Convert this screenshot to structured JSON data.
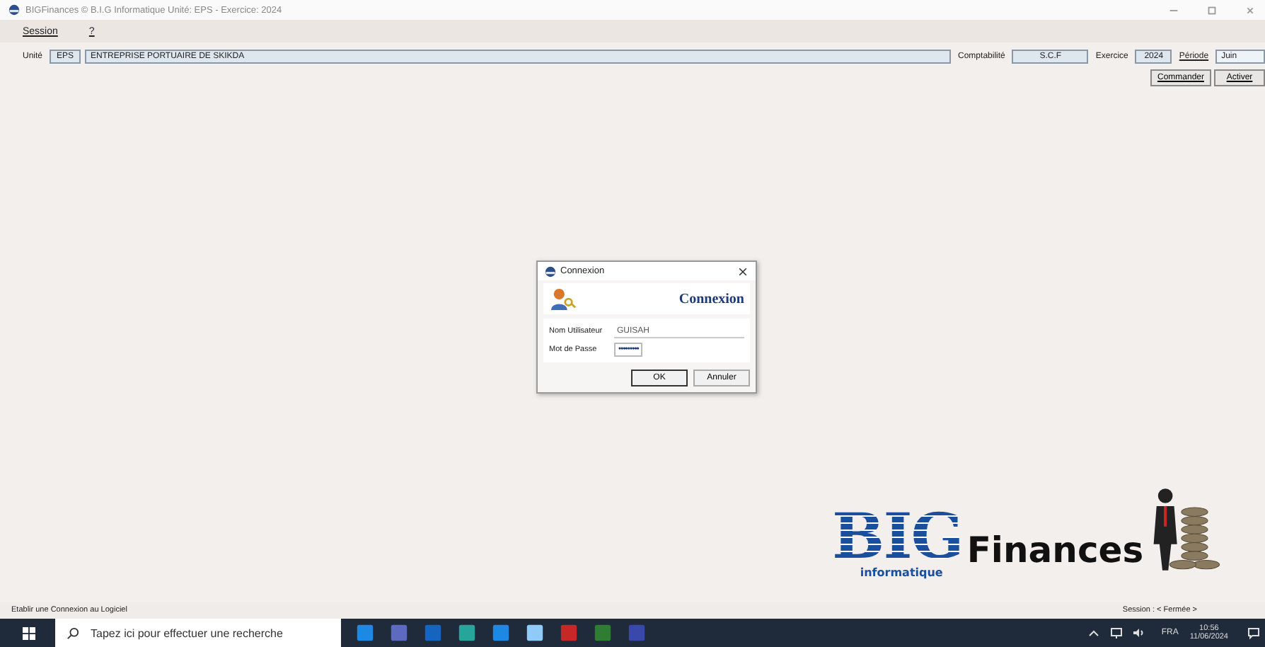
{
  "window": {
    "title": "BIGFinances © B.I.G Informatique    Unité: EPS  -  Exercice: 2024"
  },
  "menu": [
    {
      "label": "Session"
    },
    {
      "label": "?"
    }
  ],
  "info_bar": {
    "unit_label": "Unité",
    "unit_code": "EPS",
    "unit_name": "ENTREPRISE PORTUAIRE DE SKIKDA",
    "accounting_label": "Comptabilité",
    "accounting_value": "S.C.F",
    "year_label": "Exercice",
    "year_value": "2024",
    "period_label": "Période",
    "period_value": "Juin"
  },
  "actions": [
    {
      "label": "Commander"
    },
    {
      "label": "Activer"
    }
  ],
  "dialog": {
    "title": "Connexion",
    "heading": "Connexion",
    "fields": [
      {
        "label": "Nom Utilisateur",
        "value": "GUISAH",
        "kind": "text"
      },
      {
        "label": "Mot de Passe",
        "value": "•••••••••",
        "kind": "password"
      }
    ],
    "buttons": [
      {
        "label": "OK",
        "selected": true
      },
      {
        "label": "Annuler",
        "selected": false
      }
    ]
  },
  "logo": {
    "big": "BIG",
    "sub": "informatique",
    "name": "Finances"
  },
  "status_bar": {
    "message": "Etablir une Connexion au Logiciel",
    "session": "Session : < Fermée >"
  },
  "taskbar": {
    "search_placeholder": "Tapez ici pour effectuer une recherche",
    "language": "FRA",
    "time": "10:56",
    "date": "11/06/2024"
  }
}
